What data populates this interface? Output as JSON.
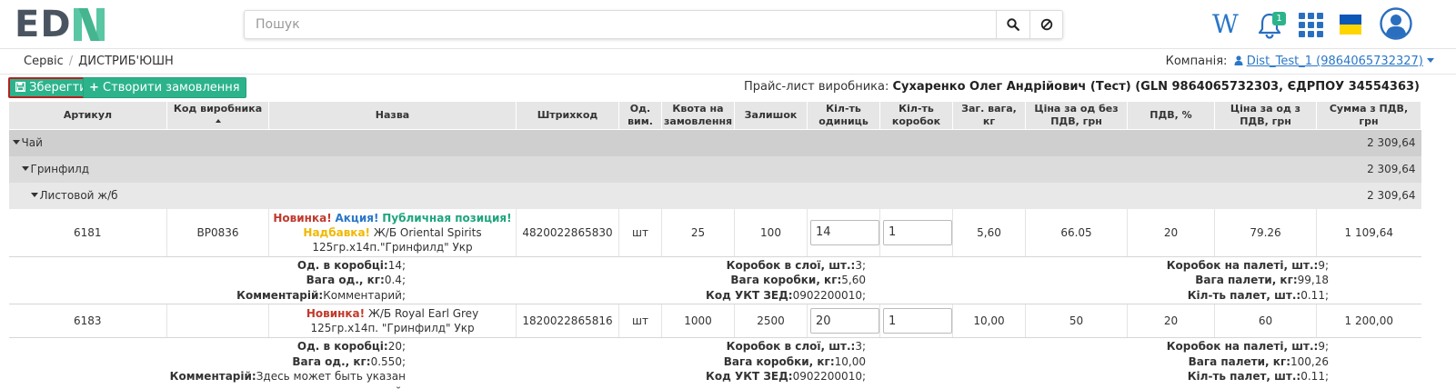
{
  "header": {
    "logo_text": "ED",
    "search_placeholder": "Пошук",
    "notifications_count": "1",
    "wiki_label": "W"
  },
  "breadcrumb": {
    "items": [
      "Сервіс",
      "ДИСТРИБ'ЮШН"
    ],
    "company_label": "Компанія:",
    "company_value": "Dist_Test_1 (9864065732327)"
  },
  "toolbar": {
    "save_label": "Зберегти",
    "create_order_label": "Створити замовлення",
    "pricelist_label": "Прайс-лист виробника:",
    "pricelist_value": "Сухаренко Олег Андрійович (Тест) (GLN 9864065732303, ЄДРПОУ 34554363)"
  },
  "table": {
    "columns": [
      "Артикул",
      "Код виробника",
      "Назва",
      "Штрихкод",
      "Од. вим.",
      "Квота на замовлення",
      "Залишок",
      "Кіл-ть одиниць",
      "Кіл-ть коробок",
      "Заг. вага, кг",
      "Ціна за од без ПДВ, грн",
      "ПДВ, %",
      "Ціна за од з ПДВ, грн",
      "Сумма з ПДВ, грн"
    ],
    "groups": [
      {
        "label": "Чай",
        "sum": "2 309,64"
      },
      {
        "label": "Гринфилд",
        "sum": "2 309,64"
      },
      {
        "label": "Листовой ж/б",
        "sum": "2 309,64"
      }
    ],
    "rows": [
      {
        "article": "6181",
        "maker_code": "BP0836",
        "tag_new": "Новинка!",
        "tag_promo": "Акция!",
        "tag_public": "Публичная позиция!",
        "tag_markup": "Надбавка!",
        "name": "Ж/Б Oriental Spirits 125гр.х14п.\"Гринфилд\" Укр",
        "barcode": "4820022865830",
        "unit": "шт",
        "quota": "25",
        "stock": "100",
        "qty_units": "14",
        "qty_boxes": "1",
        "weight": "5,60",
        "price_no_vat": "66.05",
        "vat": "20",
        "price_vat": "79.26",
        "sum_vat": "1 109,64",
        "details": {
          "units_in_box_label": "Од. в коробці:",
          "units_in_box": "14;",
          "unit_weight_label": "Вага од., кг:",
          "unit_weight": "0.4;",
          "comment_label": "Комментарій:",
          "comment": "Комментарий;",
          "boxes_layer_label": "Коробок в слої, шт.:",
          "boxes_layer": "3;",
          "box_weight_label": "Вага коробки, кг:",
          "box_weight": "5,60",
          "ukt_label": "Код УКТ ЗЕД:",
          "ukt": "0902200010;",
          "boxes_pallet_label": "Коробок на палеті, шт.:",
          "boxes_pallet": "9;",
          "pallet_weight_label": "Вага палети, кг:",
          "pallet_weight": "99,18",
          "pallets_label": "Кіл-ть палет, шт.:",
          "pallets": "0.11;"
        }
      },
      {
        "article": "6183",
        "maker_code": "",
        "tag_new": "Новинка!",
        "name": "Ж/Б Royal Earl Grey 125гр.х14п. \"Гринфилд\" Укр",
        "barcode": "1820022865816",
        "unit": "шт",
        "quota": "1000",
        "stock": "2500",
        "qty_units": "20",
        "qty_boxes": "1",
        "weight": "10,00",
        "price_no_vat": "50",
        "vat": "20",
        "price_vat": "60",
        "sum_vat": "1 200,00",
        "details": {
          "units_in_box_label": "Од. в коробці:",
          "units_in_box": "20;",
          "unit_weight_label": "Вага од., кг:",
          "unit_weight": "0.550;",
          "comment_label": "Комментарій:",
          "comment": "Здесь может быть указан комментарий;",
          "boxes_layer_label": "Коробок в слої, шт.:",
          "boxes_layer": "3;",
          "box_weight_label": "Вага коробки, кг:",
          "box_weight": "10,00",
          "ukt_label": "Код УКТ ЗЕД:",
          "ukt": "0902200010;",
          "boxes_pallet_label": "Коробок на палеті, шт.:",
          "boxes_pallet": "9;",
          "pallet_weight_label": "Вага палети, кг:",
          "pallet_weight": "100,26",
          "pallets_label": "Кіл-ть палет, шт.:",
          "pallets": "0.11;"
        }
      }
    ]
  },
  "colors": {
    "accent": "#2cb38c",
    "link": "#2a77c8",
    "save_border": "#b62020"
  }
}
